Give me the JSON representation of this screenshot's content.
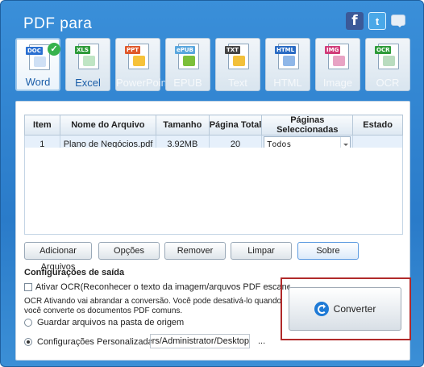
{
  "window": {
    "title": "PDF para"
  },
  "social": {
    "facebook_glyph": "f",
    "twitter_glyph": "t"
  },
  "tabs": [
    {
      "label": "Word",
      "tag": "DOC",
      "color": "#2a6fd1",
      "active": true
    },
    {
      "label": "Excel",
      "tag": "XLS",
      "color": "#2e9b3a",
      "active": false
    },
    {
      "label": "PowerPoint",
      "tag": "PPT",
      "color": "#e0582a",
      "active": false
    },
    {
      "label": "EPUB",
      "tag": "ePUB",
      "color": "#5aa7de",
      "active": false
    },
    {
      "label": "Text",
      "tag": "TXT",
      "color": "#444444",
      "active": false
    },
    {
      "label": "HTML",
      "tag": "HTML",
      "color": "#2b6cc4",
      "active": false
    },
    {
      "label": "Image",
      "tag": "IMG",
      "color": "#d13c7a",
      "active": false
    },
    {
      "label": "OCR",
      "tag": "OCR",
      "color": "#2e9b3a",
      "active": false
    }
  ],
  "table": {
    "headers": [
      "Item",
      "Nome do Arquivo",
      "Tamanho",
      "Página Total",
      "Páginas Seleccionadas",
      "Estado"
    ],
    "rows": [
      {
        "item": "1",
        "name": "Plano de Negócios.pdf",
        "size": "3.92MB",
        "pages": "20",
        "selected": "Todos",
        "status": ""
      }
    ]
  },
  "buttons": {
    "add": "Adicionar Arquivos",
    "options": "Opções",
    "remove": "Remover",
    "clear": "Limpar",
    "about": "Sobre",
    "convert": "Converter"
  },
  "output": {
    "title": "Configurações de saída",
    "ocr_label": "Ativar OCR(Reconhecer o texto da imagem/arquvos PDF escaneados",
    "ocr_note": "OCR Ativando vai abrandar a conversão. Você pode desativá-lo quando você converte os documentos PDF comuns.",
    "save_source_label": "Guardar arquivos na pasta de origem",
    "custom_label": "Configurações Personalizadas",
    "custom_path": "C:/Users/Administrator/Desktop",
    "browse": "..."
  }
}
